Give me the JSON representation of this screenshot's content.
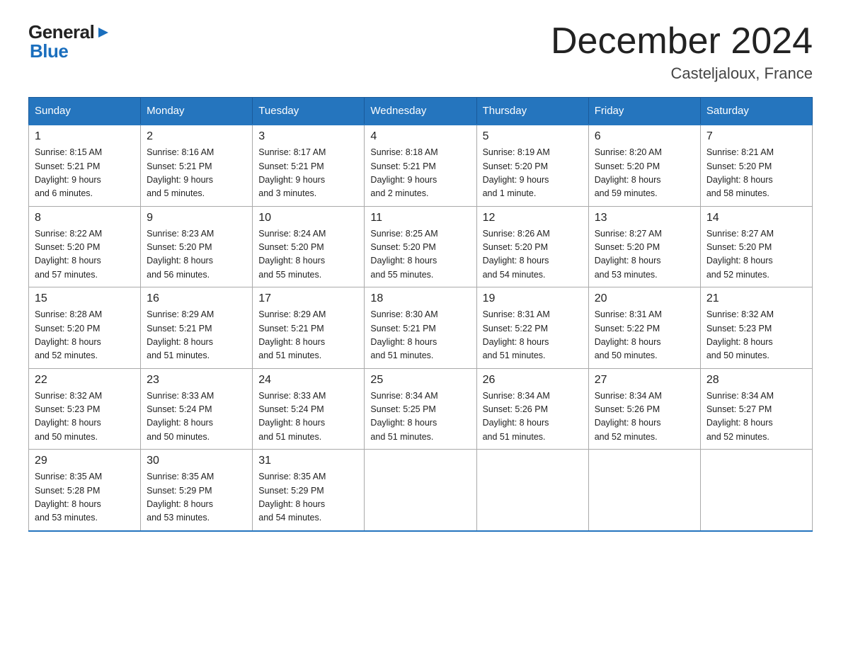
{
  "logo": {
    "general": "General",
    "blue": "Blue",
    "arrow": "▶"
  },
  "title": "December 2024",
  "subtitle": "Casteljaloux, France",
  "calendar": {
    "headers": [
      "Sunday",
      "Monday",
      "Tuesday",
      "Wednesday",
      "Thursday",
      "Friday",
      "Saturday"
    ],
    "weeks": [
      [
        {
          "day": "1",
          "info": "Sunrise: 8:15 AM\nSunset: 5:21 PM\nDaylight: 9 hours\nand 6 minutes."
        },
        {
          "day": "2",
          "info": "Sunrise: 8:16 AM\nSunset: 5:21 PM\nDaylight: 9 hours\nand 5 minutes."
        },
        {
          "day": "3",
          "info": "Sunrise: 8:17 AM\nSunset: 5:21 PM\nDaylight: 9 hours\nand 3 minutes."
        },
        {
          "day": "4",
          "info": "Sunrise: 8:18 AM\nSunset: 5:21 PM\nDaylight: 9 hours\nand 2 minutes."
        },
        {
          "day": "5",
          "info": "Sunrise: 8:19 AM\nSunset: 5:20 PM\nDaylight: 9 hours\nand 1 minute."
        },
        {
          "day": "6",
          "info": "Sunrise: 8:20 AM\nSunset: 5:20 PM\nDaylight: 8 hours\nand 59 minutes."
        },
        {
          "day": "7",
          "info": "Sunrise: 8:21 AM\nSunset: 5:20 PM\nDaylight: 8 hours\nand 58 minutes."
        }
      ],
      [
        {
          "day": "8",
          "info": "Sunrise: 8:22 AM\nSunset: 5:20 PM\nDaylight: 8 hours\nand 57 minutes."
        },
        {
          "day": "9",
          "info": "Sunrise: 8:23 AM\nSunset: 5:20 PM\nDaylight: 8 hours\nand 56 minutes."
        },
        {
          "day": "10",
          "info": "Sunrise: 8:24 AM\nSunset: 5:20 PM\nDaylight: 8 hours\nand 55 minutes."
        },
        {
          "day": "11",
          "info": "Sunrise: 8:25 AM\nSunset: 5:20 PM\nDaylight: 8 hours\nand 55 minutes."
        },
        {
          "day": "12",
          "info": "Sunrise: 8:26 AM\nSunset: 5:20 PM\nDaylight: 8 hours\nand 54 minutes."
        },
        {
          "day": "13",
          "info": "Sunrise: 8:27 AM\nSunset: 5:20 PM\nDaylight: 8 hours\nand 53 minutes."
        },
        {
          "day": "14",
          "info": "Sunrise: 8:27 AM\nSunset: 5:20 PM\nDaylight: 8 hours\nand 52 minutes."
        }
      ],
      [
        {
          "day": "15",
          "info": "Sunrise: 8:28 AM\nSunset: 5:20 PM\nDaylight: 8 hours\nand 52 minutes."
        },
        {
          "day": "16",
          "info": "Sunrise: 8:29 AM\nSunset: 5:21 PM\nDaylight: 8 hours\nand 51 minutes."
        },
        {
          "day": "17",
          "info": "Sunrise: 8:29 AM\nSunset: 5:21 PM\nDaylight: 8 hours\nand 51 minutes."
        },
        {
          "day": "18",
          "info": "Sunrise: 8:30 AM\nSunset: 5:21 PM\nDaylight: 8 hours\nand 51 minutes."
        },
        {
          "day": "19",
          "info": "Sunrise: 8:31 AM\nSunset: 5:22 PM\nDaylight: 8 hours\nand 51 minutes."
        },
        {
          "day": "20",
          "info": "Sunrise: 8:31 AM\nSunset: 5:22 PM\nDaylight: 8 hours\nand 50 minutes."
        },
        {
          "day": "21",
          "info": "Sunrise: 8:32 AM\nSunset: 5:23 PM\nDaylight: 8 hours\nand 50 minutes."
        }
      ],
      [
        {
          "day": "22",
          "info": "Sunrise: 8:32 AM\nSunset: 5:23 PM\nDaylight: 8 hours\nand 50 minutes."
        },
        {
          "day": "23",
          "info": "Sunrise: 8:33 AM\nSunset: 5:24 PM\nDaylight: 8 hours\nand 50 minutes."
        },
        {
          "day": "24",
          "info": "Sunrise: 8:33 AM\nSunset: 5:24 PM\nDaylight: 8 hours\nand 51 minutes."
        },
        {
          "day": "25",
          "info": "Sunrise: 8:34 AM\nSunset: 5:25 PM\nDaylight: 8 hours\nand 51 minutes."
        },
        {
          "day": "26",
          "info": "Sunrise: 8:34 AM\nSunset: 5:26 PM\nDaylight: 8 hours\nand 51 minutes."
        },
        {
          "day": "27",
          "info": "Sunrise: 8:34 AM\nSunset: 5:26 PM\nDaylight: 8 hours\nand 52 minutes."
        },
        {
          "day": "28",
          "info": "Sunrise: 8:34 AM\nSunset: 5:27 PM\nDaylight: 8 hours\nand 52 minutes."
        }
      ],
      [
        {
          "day": "29",
          "info": "Sunrise: 8:35 AM\nSunset: 5:28 PM\nDaylight: 8 hours\nand 53 minutes."
        },
        {
          "day": "30",
          "info": "Sunrise: 8:35 AM\nSunset: 5:29 PM\nDaylight: 8 hours\nand 53 minutes."
        },
        {
          "day": "31",
          "info": "Sunrise: 8:35 AM\nSunset: 5:29 PM\nDaylight: 8 hours\nand 54 minutes."
        },
        {
          "day": "",
          "info": ""
        },
        {
          "day": "",
          "info": ""
        },
        {
          "day": "",
          "info": ""
        },
        {
          "day": "",
          "info": ""
        }
      ]
    ]
  }
}
